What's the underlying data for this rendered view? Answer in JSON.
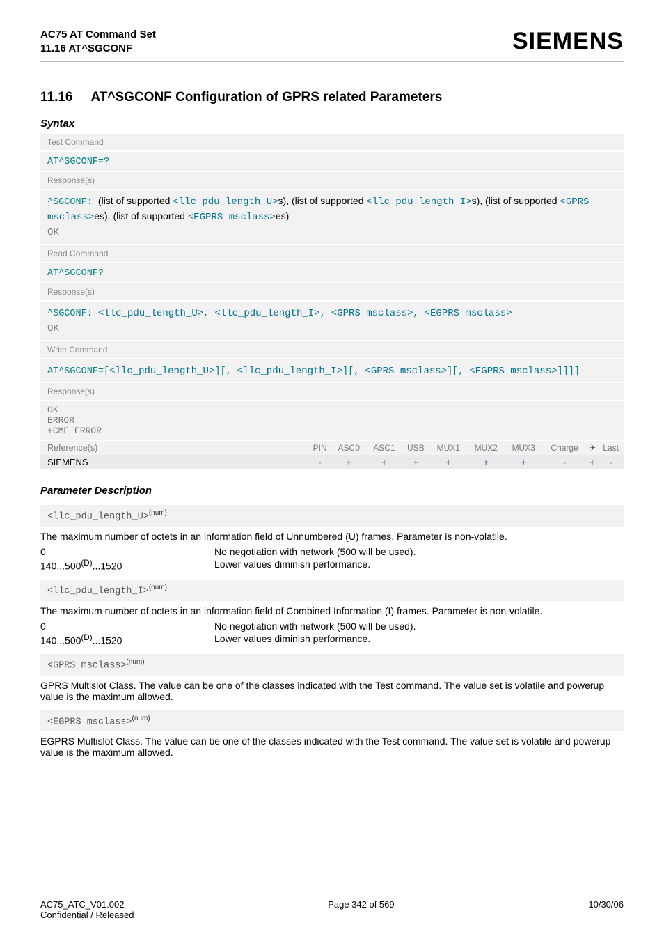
{
  "header": {
    "doc_title": "AC75 AT Command Set",
    "doc_sub": "11.16 AT^SGCONF",
    "brand": "SIEMENS"
  },
  "section": {
    "number": "11.16",
    "title": "AT^SGCONF   Configuration of GPRS related Parameters",
    "syntax_label": "Syntax"
  },
  "test_cmd": {
    "label": "Test Command",
    "command": "AT^SGCONF=?",
    "resp_label": "Response(s)",
    "resp_prefix": "^SGCONF: ",
    "resp_t1": "(list of supported ",
    "p1": "<llc_pdu_length_U>",
    "resp_t2": "s), (list of supported ",
    "p2": "<llc_pdu_length_I>",
    "resp_t3": "s), (list of supported ",
    "p3": "<GPRS msclass>",
    "resp_t4": "es), (list of supported ",
    "p4": "<EGPRS msclass>",
    "resp_t5": "es)",
    "ok": "OK"
  },
  "read_cmd": {
    "label": "Read Command",
    "command": "AT^SGCONF?",
    "resp_label": "Response(s)",
    "resp_prefix": "^SGCONF: ",
    "p1": "<llc_pdu_length_U>",
    "p2": "<llc_pdu_length_I>",
    "p3": "<GPRS msclass>",
    "p4": "<EGPRS msclass>",
    "sep": ", ",
    "ok": "OK"
  },
  "write_cmd": {
    "label": "Write Command",
    "prefix": "AT^SGCONF=",
    "b_open": "[",
    "b_close": "]",
    "comma_open": "[, ",
    "p1": "<llc_pdu_length_U>",
    "p2": "<llc_pdu_length_I>",
    "p3": "<GPRS msclass>",
    "p4": "<EGPRS msclass>",
    "tail": "]]]]",
    "resp_label": "Response(s)",
    "ok": "OK",
    "err": "ERROR",
    "cme": "+CME ERROR"
  },
  "matrix": {
    "ref_label": "Reference(s)",
    "cols": [
      "PIN",
      "ASC0",
      "ASC1",
      "USB",
      "MUX1",
      "MUX2",
      "MUX3",
      "Charge",
      "✈",
      "Last"
    ],
    "vendor": "SIEMENS",
    "vals": [
      "-",
      "+",
      "+",
      "+",
      "+",
      "+",
      "+",
      "-",
      "+",
      "-"
    ]
  },
  "param_desc_label": "Parameter Description",
  "params": {
    "u": {
      "name": "<llc_pdu_length_U>",
      "sup": "(num)",
      "desc": "The maximum number of octets in an information field of Unnumbered (U) frames. Parameter is non-volatile.",
      "r1k": "0",
      "r1v": "No negotiation with network (500 will be used).",
      "r2k_a": "140...500",
      "r2k_sup": "(D)",
      "r2k_b": "...1520",
      "r2v": "Lower values diminish performance."
    },
    "i": {
      "name": "<llc_pdu_length_I>",
      "sup": "(num)",
      "desc": "The maximum number of octets in an information field of Combined Information (I) frames. Parameter is non-volatile.",
      "r1k": "0",
      "r1v": "No negotiation with network (500 will be used).",
      "r2k_a": "140...500",
      "r2k_sup": "(D)",
      "r2k_b": "...1520",
      "r2v": "Lower values diminish performance."
    },
    "g": {
      "name": "<GPRS msclass>",
      "sup": "(num)",
      "desc": "GPRS Multislot Class. The value can be one of the classes indicated with the Test command. The value set is volatile and powerup value is the maximum allowed."
    },
    "e": {
      "name": "<EGPRS msclass>",
      "sup": "(num)",
      "desc": "EGPRS Multislot Class. The value can be one of the classes indicated with the Test command. The value set is volatile and powerup value is the maximum allowed."
    }
  },
  "footer": {
    "left1": "AC75_ATC_V01.002",
    "left2": "Confidential / Released",
    "center": "Page 342 of 569",
    "right": "10/30/06"
  }
}
